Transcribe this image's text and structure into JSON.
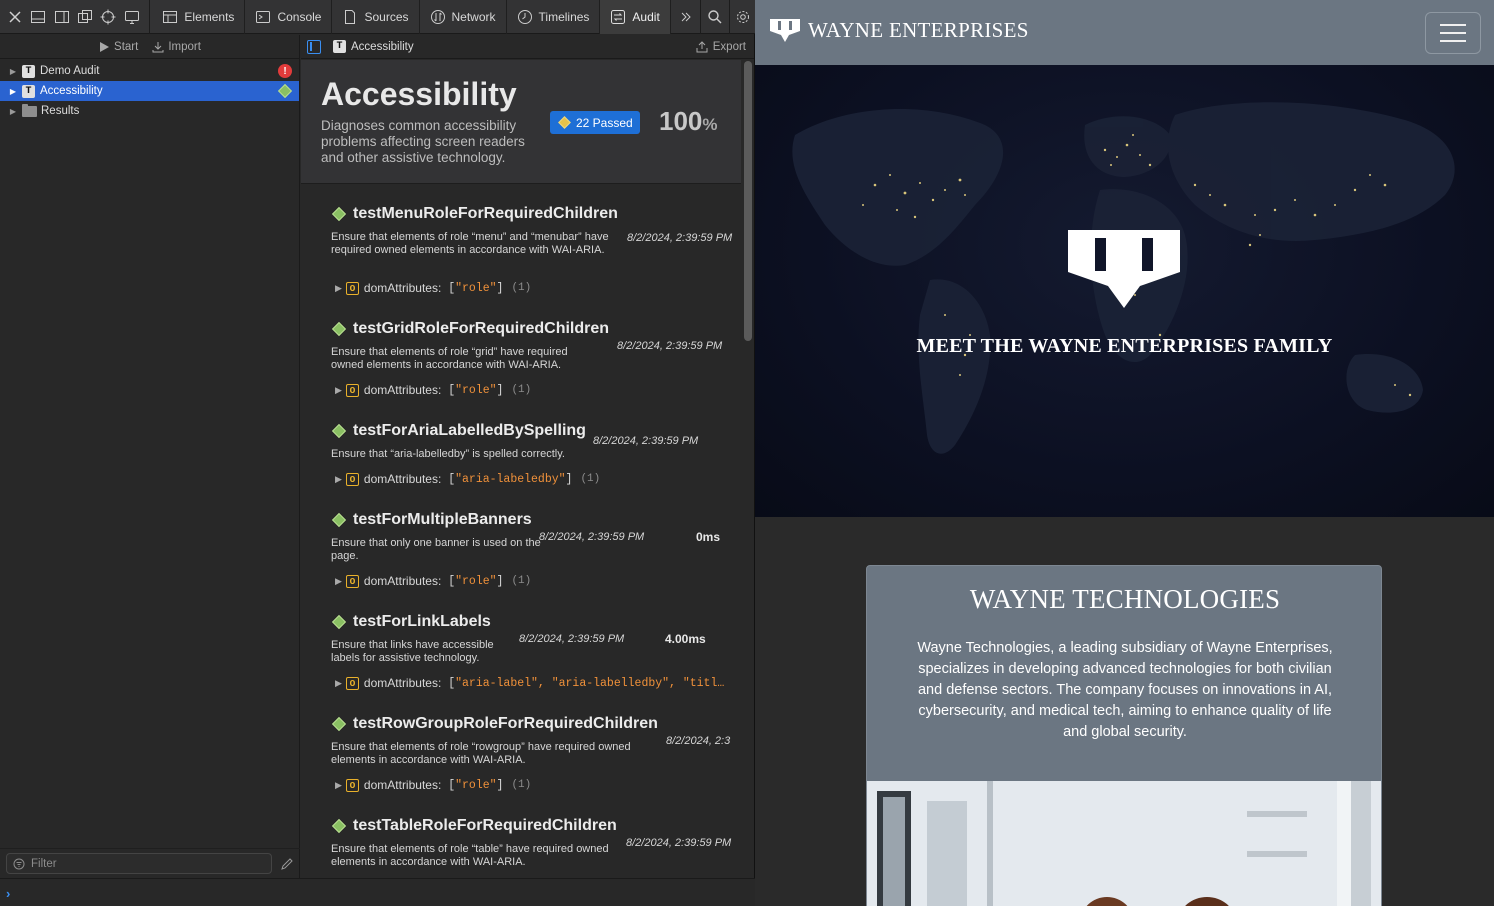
{
  "toolbar": {
    "tabs": [
      {
        "label": "Elements",
        "icon": "elements-icon"
      },
      {
        "label": "Console",
        "icon": "console-icon"
      },
      {
        "label": "Sources",
        "icon": "sources-icon"
      },
      {
        "label": "Network",
        "icon": "network-icon"
      },
      {
        "label": "Timelines",
        "icon": "timelines-icon"
      },
      {
        "label": "Audit",
        "icon": "audit-icon",
        "active": true
      }
    ]
  },
  "left_pane": {
    "start_label": "Start",
    "import_label": "Import",
    "tree": [
      {
        "badge": "T",
        "label": "Demo Audit",
        "status": "error"
      },
      {
        "badge": "T",
        "label": "Accessibility",
        "status": "pass",
        "selected": true
      },
      {
        "badge": "folder",
        "label": "Results"
      }
    ],
    "filter_placeholder": "Filter"
  },
  "right_pane": {
    "header_badge": "T",
    "header_label": "Accessibility",
    "export_label": "Export",
    "audit": {
      "title": "Accessibility",
      "description": "Diagnoses common accessibility problems affecting screen readers and other assistive technology.",
      "passed_label": "22 Passed",
      "percent": "100",
      "percent_unit": "%"
    },
    "tests": [
      {
        "name": "testMenuRoleForRequiredChildren",
        "desc": "Ensure that elements of role “menu” and “menubar” have required owned elements in accordance with WAI-ARIA.",
        "date": "8/2/2024, 2:39:59 PM",
        "duration": "",
        "attr_key": "domAttributes:",
        "attr_values": "\"role\"",
        "attr_count": "(1)"
      },
      {
        "name": "testGridRoleForRequiredChildren",
        "desc": "Ensure that elements of role “grid” have required owned elements in accordance with WAI-ARIA.",
        "date": "8/2/2024, 2:39:59 PM",
        "duration": "",
        "attr_key": "domAttributes:",
        "attr_values": "\"role\"",
        "attr_count": "(1)"
      },
      {
        "name": "testForAriaLabelledBySpelling",
        "desc": "Ensure that “aria-labelledby” is spelled correctly.",
        "date": "8/2/2024, 2:39:59 PM",
        "duration": "",
        "attr_key": "domAttributes:",
        "attr_values": "\"aria-labeledby\"",
        "attr_count": "(1)"
      },
      {
        "name": "testForMultipleBanners",
        "desc": "Ensure that only one banner is used on the page.",
        "date": "8/2/2024, 2:39:59 PM",
        "duration": "0ms",
        "attr_key": "domAttributes:",
        "attr_values": "\"role\"",
        "attr_count": "(1)"
      },
      {
        "name": "testForLinkLabels",
        "desc": "Ensure that links have accessible labels for assistive technology.",
        "date": "8/2/2024, 2:39:59 PM",
        "duration": "4.00ms",
        "attr_key": "domAttributes:",
        "attr_values": "\"aria-label\", \"aria-labelledby\", \"titl…",
        "attr_count": ""
      },
      {
        "name": "testRowGroupRoleForRequiredChildren",
        "desc": "Ensure that elements of role “rowgroup” have required owned elements in accordance with WAI-ARIA.",
        "date": "8/2/2024, 2:3",
        "duration": "",
        "attr_key": "domAttributes:",
        "attr_values": "\"role\"",
        "attr_count": "(1)"
      },
      {
        "name": "testTableRoleForRequiredChildren",
        "desc": "Ensure that elements of role “table” have required owned elements in accordance with WAI-ARIA.",
        "date": "8/2/2024, 2:39:59 PM",
        "duration": "",
        "attr_key": "",
        "attr_values": "",
        "attr_count": ""
      }
    ]
  },
  "site": {
    "brand": "WAYNE ENTERPRISES",
    "hero_text": "MEET THE WAYNE ENTERPRISES FAMILY",
    "card_title": "WAYNE TECHNOLOGIES",
    "card_body": "Wayne Technologies, a leading subsidiary of Wayne Enterprises, specializes in developing advanced technologies for both civilian and defense sectors. The company focuses on innovations in AI, cybersecurity, and medical tech, aiming to enhance quality of life and global security."
  },
  "colors": {
    "selection": "#2a63d0",
    "pass_badge": "#1e6fd6",
    "navbar": "#6b7682",
    "pass_diamond": "#8ac063",
    "error_dot": "#e23b3b"
  }
}
